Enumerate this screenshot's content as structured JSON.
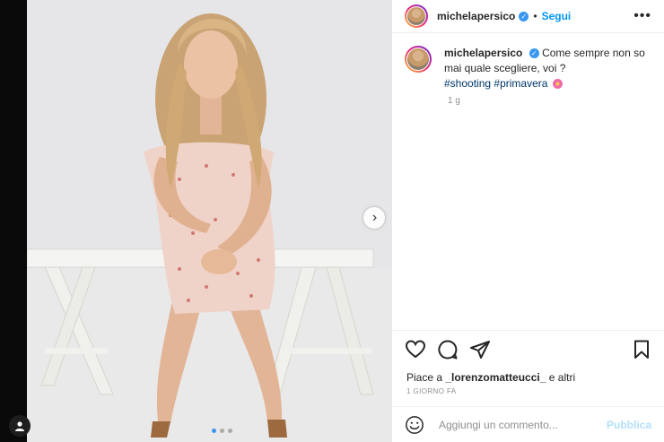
{
  "post": {
    "username": "michelapersico",
    "follow_label": "Segui",
    "bullet": "•",
    "more_label": "•••",
    "caption_text": "Come sempre non so mai quale scegliere, voi ?",
    "hashtag_1": "#shooting",
    "hashtag_2": "#primavera",
    "caption_time": "1 g",
    "likes_prefix": "Piace a",
    "likes_user": "_lorenzomatteucci_",
    "likes_suffix": "e altri",
    "date": "1 GIORNO FA"
  },
  "comment": {
    "placeholder": "Aggiungi un commento...",
    "publish_label": "Pubblica"
  },
  "carousel": {
    "next_glyph": "›",
    "slide_count": 3,
    "active_slide": 1
  },
  "colors": {
    "accent": "#0095f6",
    "verified": "#3897f0",
    "publish_disabled": "#b2dffc"
  },
  "icons": [
    "heart-icon",
    "comment-icon",
    "share-icon",
    "bookmark-icon",
    "emoji-icon",
    "user-tag-icon",
    "verified-badge-icon"
  ]
}
